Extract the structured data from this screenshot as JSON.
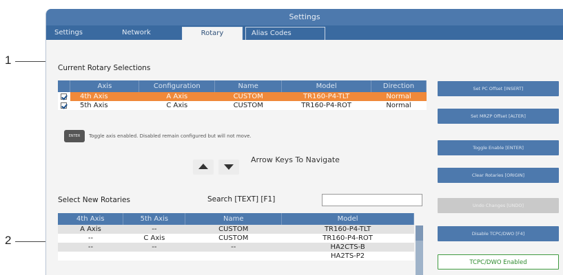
{
  "callouts": {
    "one": "1",
    "two": "2"
  },
  "window": {
    "title": "Settings"
  },
  "tabs": [
    {
      "label": "Settings"
    },
    {
      "label": "Network"
    },
    {
      "label": "Rotary"
    },
    {
      "label": "Alias Codes"
    }
  ],
  "current": {
    "title": "Current Rotary Selections",
    "columns": [
      "",
      "Axis",
      "Configuration",
      "Name",
      "Model",
      "Direction"
    ],
    "rows": [
      {
        "axis": "4th Axis",
        "config": "A Axis",
        "name": "CUSTOM",
        "model": "TR160-P4-TLT",
        "direction": "Normal"
      },
      {
        "axis": "5th Axis",
        "config": "C Axis",
        "name": "CUSTOM",
        "model": "TR160-P4-ROT",
        "direction": "Normal"
      }
    ]
  },
  "toggle": {
    "key": "ENTER",
    "hint": "Toggle axis enabled. Disabled remain configured but will not move."
  },
  "navigate": {
    "text": "Arrow Keys To Navigate"
  },
  "select": {
    "title": "Select New Rotaries",
    "search_label": "Search [TEXT] [F1]",
    "search_value": "",
    "columns": [
      "4th Axis",
      "5th Axis",
      "Name",
      "Model"
    ],
    "rows": [
      {
        "fourth": "A Axis",
        "fifth": "--",
        "name": "CUSTOM",
        "model": "TR160-P4-TLT"
      },
      {
        "fourth": "--",
        "fifth": "C Axis",
        "name": "CUSTOM",
        "model": "TR160-P4-ROT"
      },
      {
        "fourth": "--",
        "fifth": "--",
        "name": "--",
        "model": "HA2CTS-B"
      },
      {
        "fourth": "",
        "fifth": "",
        "name": "",
        "model": "HA2TS-P2"
      }
    ]
  },
  "side_buttons": [
    {
      "label": "Set PC Offset [INSERT]"
    },
    {
      "label": "Set MRZP Offset [ALTER]"
    },
    {
      "label": "Toggle Enable [ENTER]"
    },
    {
      "label": "Clear Rotaries [ORIGIN]"
    },
    {
      "label": "Undo Changes [UNDO]"
    },
    {
      "label": "Disable TCPC/DWO [F4]"
    },
    {
      "label": "TCPC/DWO Enabled"
    }
  ],
  "colors": {
    "accent": "#4d79ad",
    "selected_row": "#f0893a",
    "status_green": "#3e9a3e"
  }
}
